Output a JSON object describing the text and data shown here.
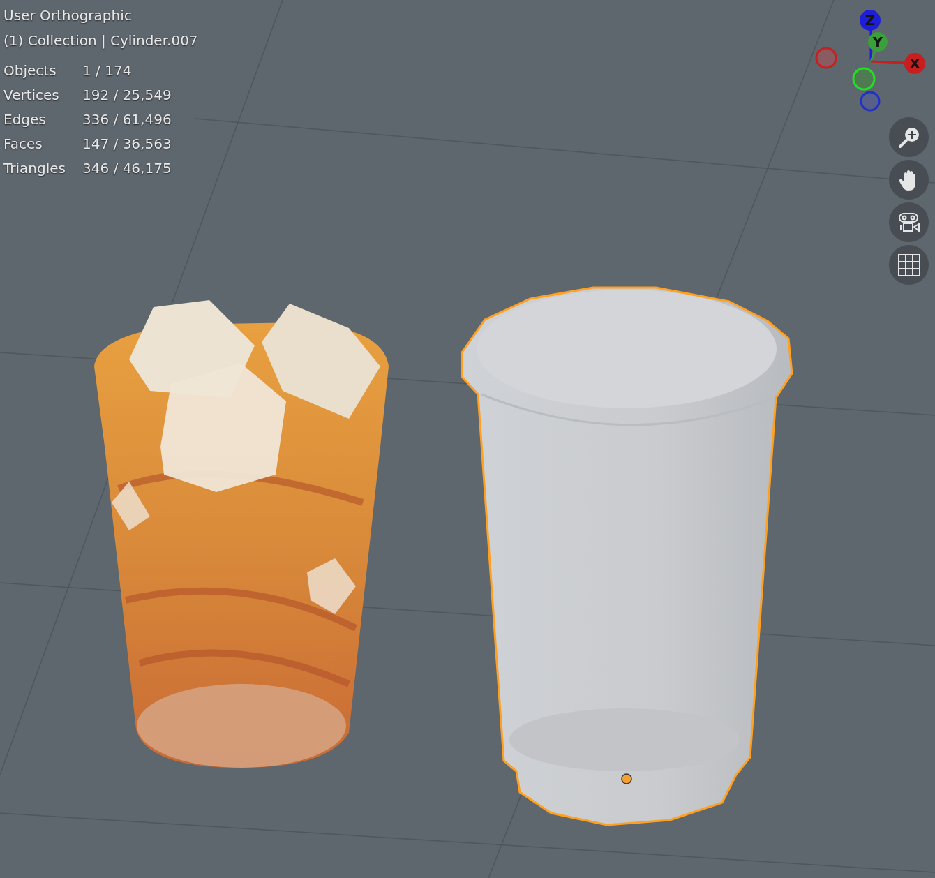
{
  "viewport": {
    "view_name": "User Orthographic",
    "context": "(1) Collection | Cylinder.007",
    "stats": [
      {
        "label": "Objects",
        "value": "1 / 174"
      },
      {
        "label": "Vertices",
        "value": "192 / 25,549"
      },
      {
        "label": "Edges",
        "value": "336 / 61,496"
      },
      {
        "label": "Faces",
        "value": "147 / 36,563"
      },
      {
        "label": "Triangles",
        "value": "346 / 46,175"
      }
    ]
  },
  "objects": [
    {
      "kind": "iced-drink",
      "selected": false
    },
    {
      "kind": "cup",
      "selected": true
    }
  ],
  "gizmo": {
    "axes": [
      {
        "label": "Z",
        "color": "#1e1ed6"
      },
      {
        "label": "Y",
        "color": "#3aa03a"
      },
      {
        "label": "X",
        "color": "#c81e1e"
      }
    ]
  },
  "nav_buttons": [
    {
      "kind": "zoom"
    },
    {
      "kind": "pan"
    },
    {
      "kind": "camera"
    },
    {
      "kind": "grid"
    }
  ]
}
